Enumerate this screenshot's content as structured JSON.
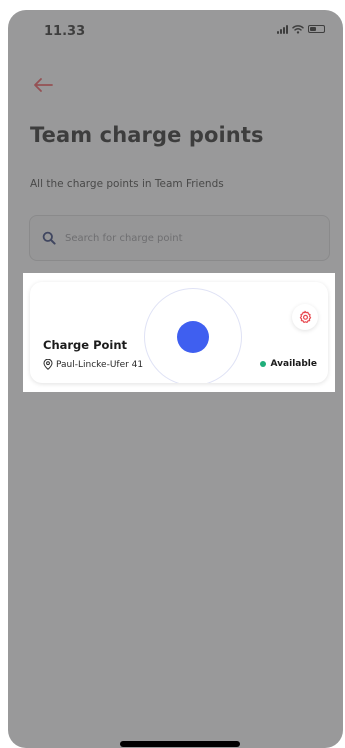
{
  "status_bar": {
    "time": "11.33"
  },
  "header": {
    "title": "Team charge points",
    "subtitle": "All the charge points in Team Friends"
  },
  "search": {
    "placeholder": "Search for charge point",
    "value": ""
  },
  "charge_points": [
    {
      "name": "Charge Point",
      "address": "Paul-Lincke-Ufer 41",
      "status": "Available",
      "status_color": "#1fae7a"
    }
  ],
  "colors": {
    "accent": "#e8484f",
    "touch_indicator": "#3f5ff0",
    "title_text": "#1a1a1a"
  },
  "icons": {
    "back": "arrow-left-icon",
    "search": "search-icon",
    "location": "location-pin-icon",
    "settings": "gear-icon",
    "signal": "signal-icon",
    "wifi": "wifi-icon",
    "battery": "battery-icon"
  }
}
